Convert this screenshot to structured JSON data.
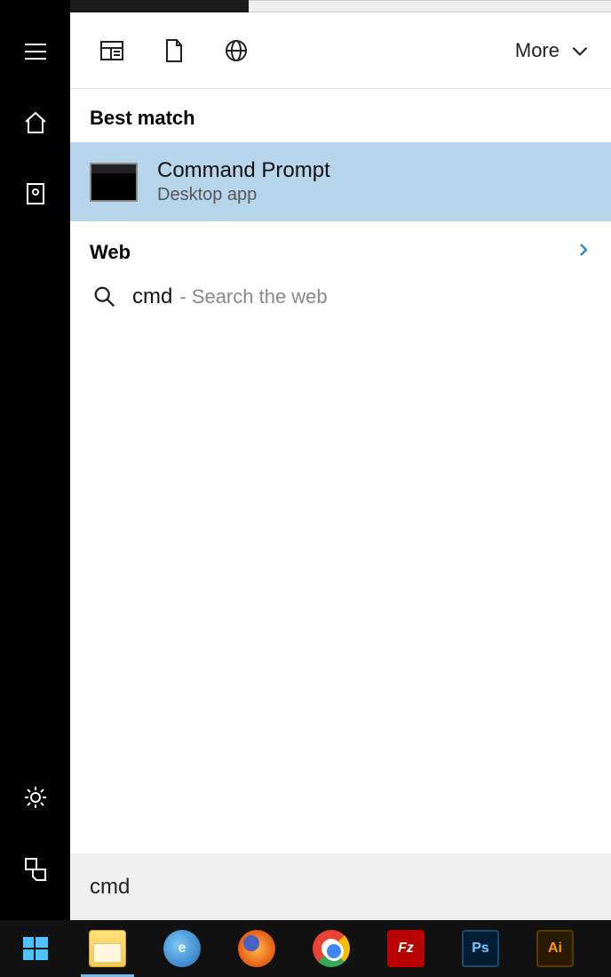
{
  "top_filters": {
    "more_label": "More"
  },
  "sections": {
    "best_match_label": "Best match",
    "web_label": "Web"
  },
  "best_match": {
    "title": "Command Prompt",
    "subtitle": "Desktop app"
  },
  "web_result": {
    "query": "cmd",
    "hint": "- Search the web"
  },
  "search_box": {
    "value": "cmd"
  },
  "sidebar_icons": {
    "menu": "hamburger-icon",
    "home": "home-icon",
    "notebook": "notebook-icon",
    "settings": "gear-icon",
    "feedback": "feedback-icon"
  },
  "taskbar": {
    "items": [
      {
        "name": "file-explorer",
        "label": ""
      },
      {
        "name": "internet-explorer",
        "label": "e"
      },
      {
        "name": "firefox",
        "label": ""
      },
      {
        "name": "chrome",
        "label": ""
      },
      {
        "name": "filezilla",
        "label": "Fz"
      },
      {
        "name": "photoshop",
        "label": "Ps"
      },
      {
        "name": "illustrator",
        "label": "Ai"
      }
    ]
  }
}
